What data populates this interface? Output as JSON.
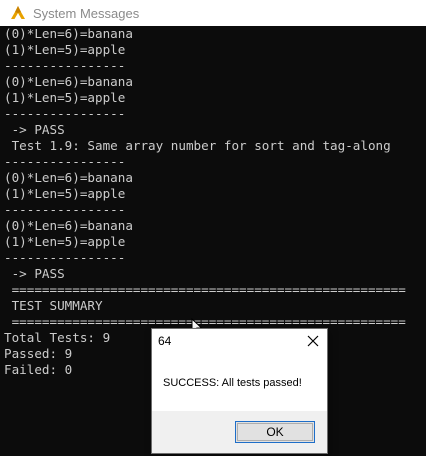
{
  "window": {
    "title": "System Messages",
    "icon": "app-logo-icon"
  },
  "console": {
    "lines": [
      "(0)*Len=6)=banana",
      "(1)*Len=5)=apple",
      "----------------",
      "(0)*Len=6)=banana",
      "(1)*Len=5)=apple",
      "----------------",
      " -> PASS",
      " Test 1.9: Same array number for sort and tag-along",
      "----------------",
      "(0)*Len=6)=banana",
      "(1)*Len=5)=apple",
      "----------------",
      "(0)*Len=6)=banana",
      "(1)*Len=5)=apple",
      "----------------",
      " -> PASS",
      " ====================================================",
      " TEST SUMMARY",
      " ====================================================",
      "Total Tests: 9",
      "Passed: 9",
      "Failed: 0"
    ]
  },
  "dialog": {
    "title": "64",
    "message": "SUCCESS: All tests passed!",
    "ok_label": "OK",
    "close_icon": "close-icon"
  },
  "colors": {
    "console_bg": "#0c0c0c",
    "console_text": "#cccccc",
    "dialog_bg": "#f0f0f0",
    "accent": "#1e6ec8"
  }
}
